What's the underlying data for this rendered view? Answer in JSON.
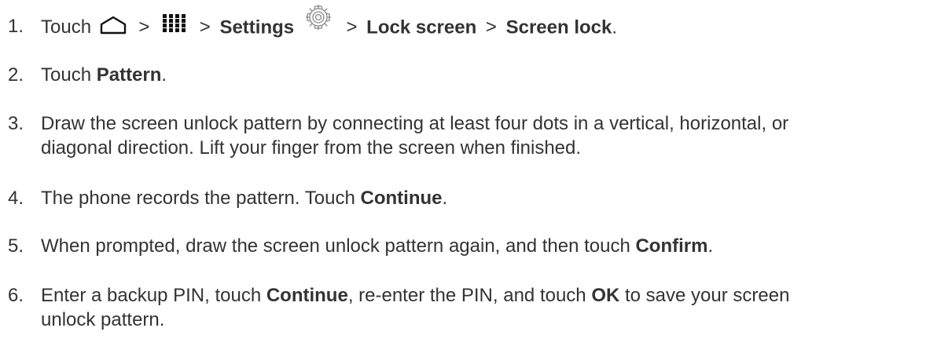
{
  "steps": [
    {
      "number": "1.",
      "parts": {
        "touch": "Touch",
        "sep1": ">",
        "sep2": ">",
        "settings": "Settings",
        "sep3": ">",
        "lock_screen": "Lock screen",
        "sep4": ">",
        "screen_lock": "Screen lock",
        "end": "."
      },
      "icons": [
        "home-icon",
        "apps-icon",
        "gear-icon"
      ]
    },
    {
      "number": "2.",
      "parts": {
        "touch": "Touch ",
        "pattern": "Pattern",
        "end": "."
      }
    },
    {
      "number": "3.",
      "parts": {
        "line1": "Draw the screen unlock pattern by connecting at least four dots in a vertical, horizontal, or",
        "line2": "diagonal direction. Lift your finger from the screen when finished."
      }
    },
    {
      "number": "4.",
      "parts": {
        "text": "The phone records the pattern. Touch ",
        "continue": "Continue",
        "end": "."
      }
    },
    {
      "number": "5.",
      "parts": {
        "text": "When prompted, draw the screen unlock pattern again, and then touch ",
        "confirm": "Confirm",
        "end": "."
      }
    },
    {
      "number": "6.",
      "parts": {
        "text1": "Enter a backup PIN, touch ",
        "continue": "Continue",
        "text2": ", re-enter the PIN, and touch ",
        "ok": "OK",
        "text3": " to save your screen",
        "line2": "unlock pattern."
      }
    }
  ]
}
